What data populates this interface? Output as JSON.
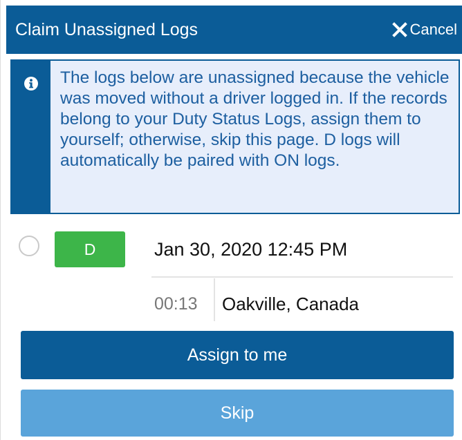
{
  "header": {
    "title": "Claim Unassigned Logs",
    "cancel_label": "Cancel",
    "cancel_icon": "close-icon"
  },
  "info": {
    "icon": "info-icon",
    "message": "The logs below are unassigned because the vehicle was moved without a driver logged in. If the records belong to your Duty Status Logs, assign them to yourself; otherwise, skip this page. D logs will automatically be paired with ON logs."
  },
  "logs": [
    {
      "status": "D",
      "status_color": "#3db549",
      "datetime": "Jan 30, 2020 12:45 PM",
      "duration": "00:13",
      "location": "Oakville, Canada",
      "selected": false
    }
  ],
  "actions": {
    "assign_label": "Assign to me",
    "skip_label": "Skip"
  },
  "colors": {
    "primary": "#0b5c97",
    "secondary_button": "#5aa4da",
    "info_background": "#e7eefb",
    "info_text": "#1d5fa0"
  }
}
